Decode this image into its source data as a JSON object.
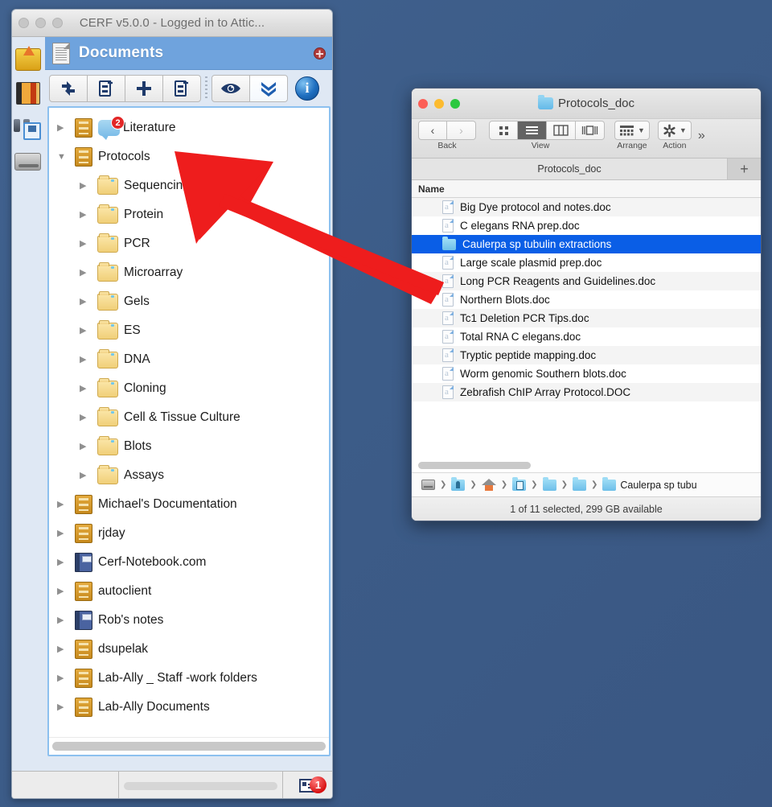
{
  "desktop": {
    "background_color": "#3e5d8b"
  },
  "cerf_window": {
    "title": "CERF v5.0.0 - Logged in to Attic...",
    "panel": {
      "title": "Documents",
      "close_label": "close"
    },
    "rail_icons": [
      {
        "name": "import-icon"
      },
      {
        "name": "book-icon"
      },
      {
        "name": "binoculars-icon"
      },
      {
        "name": "floppy-save-icon"
      },
      {
        "name": "hard-drive-icon"
      }
    ],
    "toolbar": [
      {
        "name": "refresh-sync-button",
        "icon": "refresh-arrows-icon",
        "title": "Refresh"
      },
      {
        "name": "new-record-button",
        "icon": "document-plus-icon",
        "title": "New Record"
      },
      {
        "name": "add-button",
        "icon": "plus-icon",
        "title": "Add"
      },
      {
        "name": "remove-record-button",
        "icon": "document-minus-icon",
        "title": "Remove Record"
      },
      {
        "name": "view-button",
        "icon": "eye-icon",
        "title": "View"
      },
      {
        "name": "expand-all-button",
        "icon": "double-chevron-down-icon",
        "title": "Expand All"
      },
      {
        "name": "info-button",
        "icon": "info-circle-icon",
        "title": "Info"
      }
    ],
    "tree": [
      {
        "level": 1,
        "icon": "cabinet",
        "label": "Literature",
        "expanded": false,
        "badge": "2",
        "bubble": true
      },
      {
        "level": 1,
        "icon": "cabinet",
        "label": "Protocols",
        "expanded": true
      },
      {
        "level": 2,
        "icon": "folder",
        "label": "Sequencing and HP"
      },
      {
        "level": 2,
        "icon": "folder",
        "label": "Protein"
      },
      {
        "level": 2,
        "icon": "folder",
        "label": "PCR"
      },
      {
        "level": 2,
        "icon": "folder",
        "label": "Microarray"
      },
      {
        "level": 2,
        "icon": "folder",
        "label": "Gels"
      },
      {
        "level": 2,
        "icon": "folder",
        "label": "ES"
      },
      {
        "level": 2,
        "icon": "folder",
        "label": "DNA"
      },
      {
        "level": 2,
        "icon": "folder",
        "label": "Cloning"
      },
      {
        "level": 2,
        "icon": "folder",
        "label": "Cell & Tissue Culture"
      },
      {
        "level": 2,
        "icon": "folder",
        "label": "Blots"
      },
      {
        "level": 2,
        "icon": "folder",
        "label": "Assays"
      },
      {
        "level": 1,
        "icon": "cabinet",
        "label": "Michael's Documentation"
      },
      {
        "level": 1,
        "icon": "cabinet",
        "label": "rjday"
      },
      {
        "level": 1,
        "icon": "notebook",
        "label": "Cerf-Notebook.com"
      },
      {
        "level": 1,
        "icon": "cabinet",
        "label": "autoclient"
      },
      {
        "level": 1,
        "icon": "notebook",
        "label": "Rob's notes"
      },
      {
        "level": 1,
        "icon": "cabinet",
        "label": "dsupelak"
      },
      {
        "level": 1,
        "icon": "cabinet",
        "label": "Lab-Ally _ Staff -work folders"
      },
      {
        "level": 1,
        "icon": "cabinet",
        "label": "Lab-Ally Documents"
      }
    ],
    "status_bar": {
      "badge_count": "1",
      "icon": "record-list-icon"
    }
  },
  "finder_window": {
    "title": "Protocols_doc",
    "tab_label": "Protocols_doc",
    "add_tab_label": "+",
    "toolbar": {
      "back_caption": "Back",
      "view_caption": "View",
      "arrange_caption": "Arrange",
      "action_caption": "Action",
      "back_glyph": "‹",
      "forward_glyph": "›",
      "overflow_glyph": "»",
      "view_modes": [
        "icon-view",
        "list-view",
        "column-view",
        "gallery-view"
      ],
      "selected_view": "list-view"
    },
    "column_header": "Name",
    "files": [
      {
        "name": "Big Dye protocol and notes.doc",
        "type": "doc",
        "selected": false
      },
      {
        "name": "C elegans RNA prep.doc",
        "type": "doc",
        "selected": false
      },
      {
        "name": "Caulerpa sp tubulin extractions",
        "type": "folder",
        "selected": true
      },
      {
        "name": "Large scale plasmid prep.doc",
        "type": "doc",
        "selected": false
      },
      {
        "name": "Long PCR Reagents and Guidelines.doc",
        "type": "doc",
        "selected": false
      },
      {
        "name": "Northern Blots.doc",
        "type": "doc",
        "selected": false
      },
      {
        "name": "Tc1 Deletion PCR Tips.doc",
        "type": "doc",
        "selected": false
      },
      {
        "name": "Total RNA C elegans.doc",
        "type": "doc",
        "selected": false
      },
      {
        "name": "Tryptic peptide mapping.doc",
        "type": "doc",
        "selected": false
      },
      {
        "name": "Worm genomic Southern blots.doc",
        "type": "doc",
        "selected": false
      },
      {
        "name": "Zebrafish ChIP Array Protocol.DOC",
        "type": "doc",
        "selected": false
      }
    ],
    "path_bar": [
      {
        "icon": "hard-disk-icon",
        "label": ""
      },
      {
        "icon": "users-folder-icon",
        "label": ""
      },
      {
        "icon": "home-folder-icon",
        "label": ""
      },
      {
        "icon": "documents-folder-icon",
        "label": ""
      },
      {
        "icon": "folder-icon",
        "label": ""
      },
      {
        "icon": "folder-icon",
        "label": ""
      },
      {
        "icon": "folder-icon",
        "label": "Caulerpa sp tubu"
      }
    ],
    "status_text": "1 of 11 selected, 299 GB available"
  },
  "annotation": {
    "arrow_color": "#ee1d1d",
    "arrow_name": "red-pointer-arrow"
  }
}
